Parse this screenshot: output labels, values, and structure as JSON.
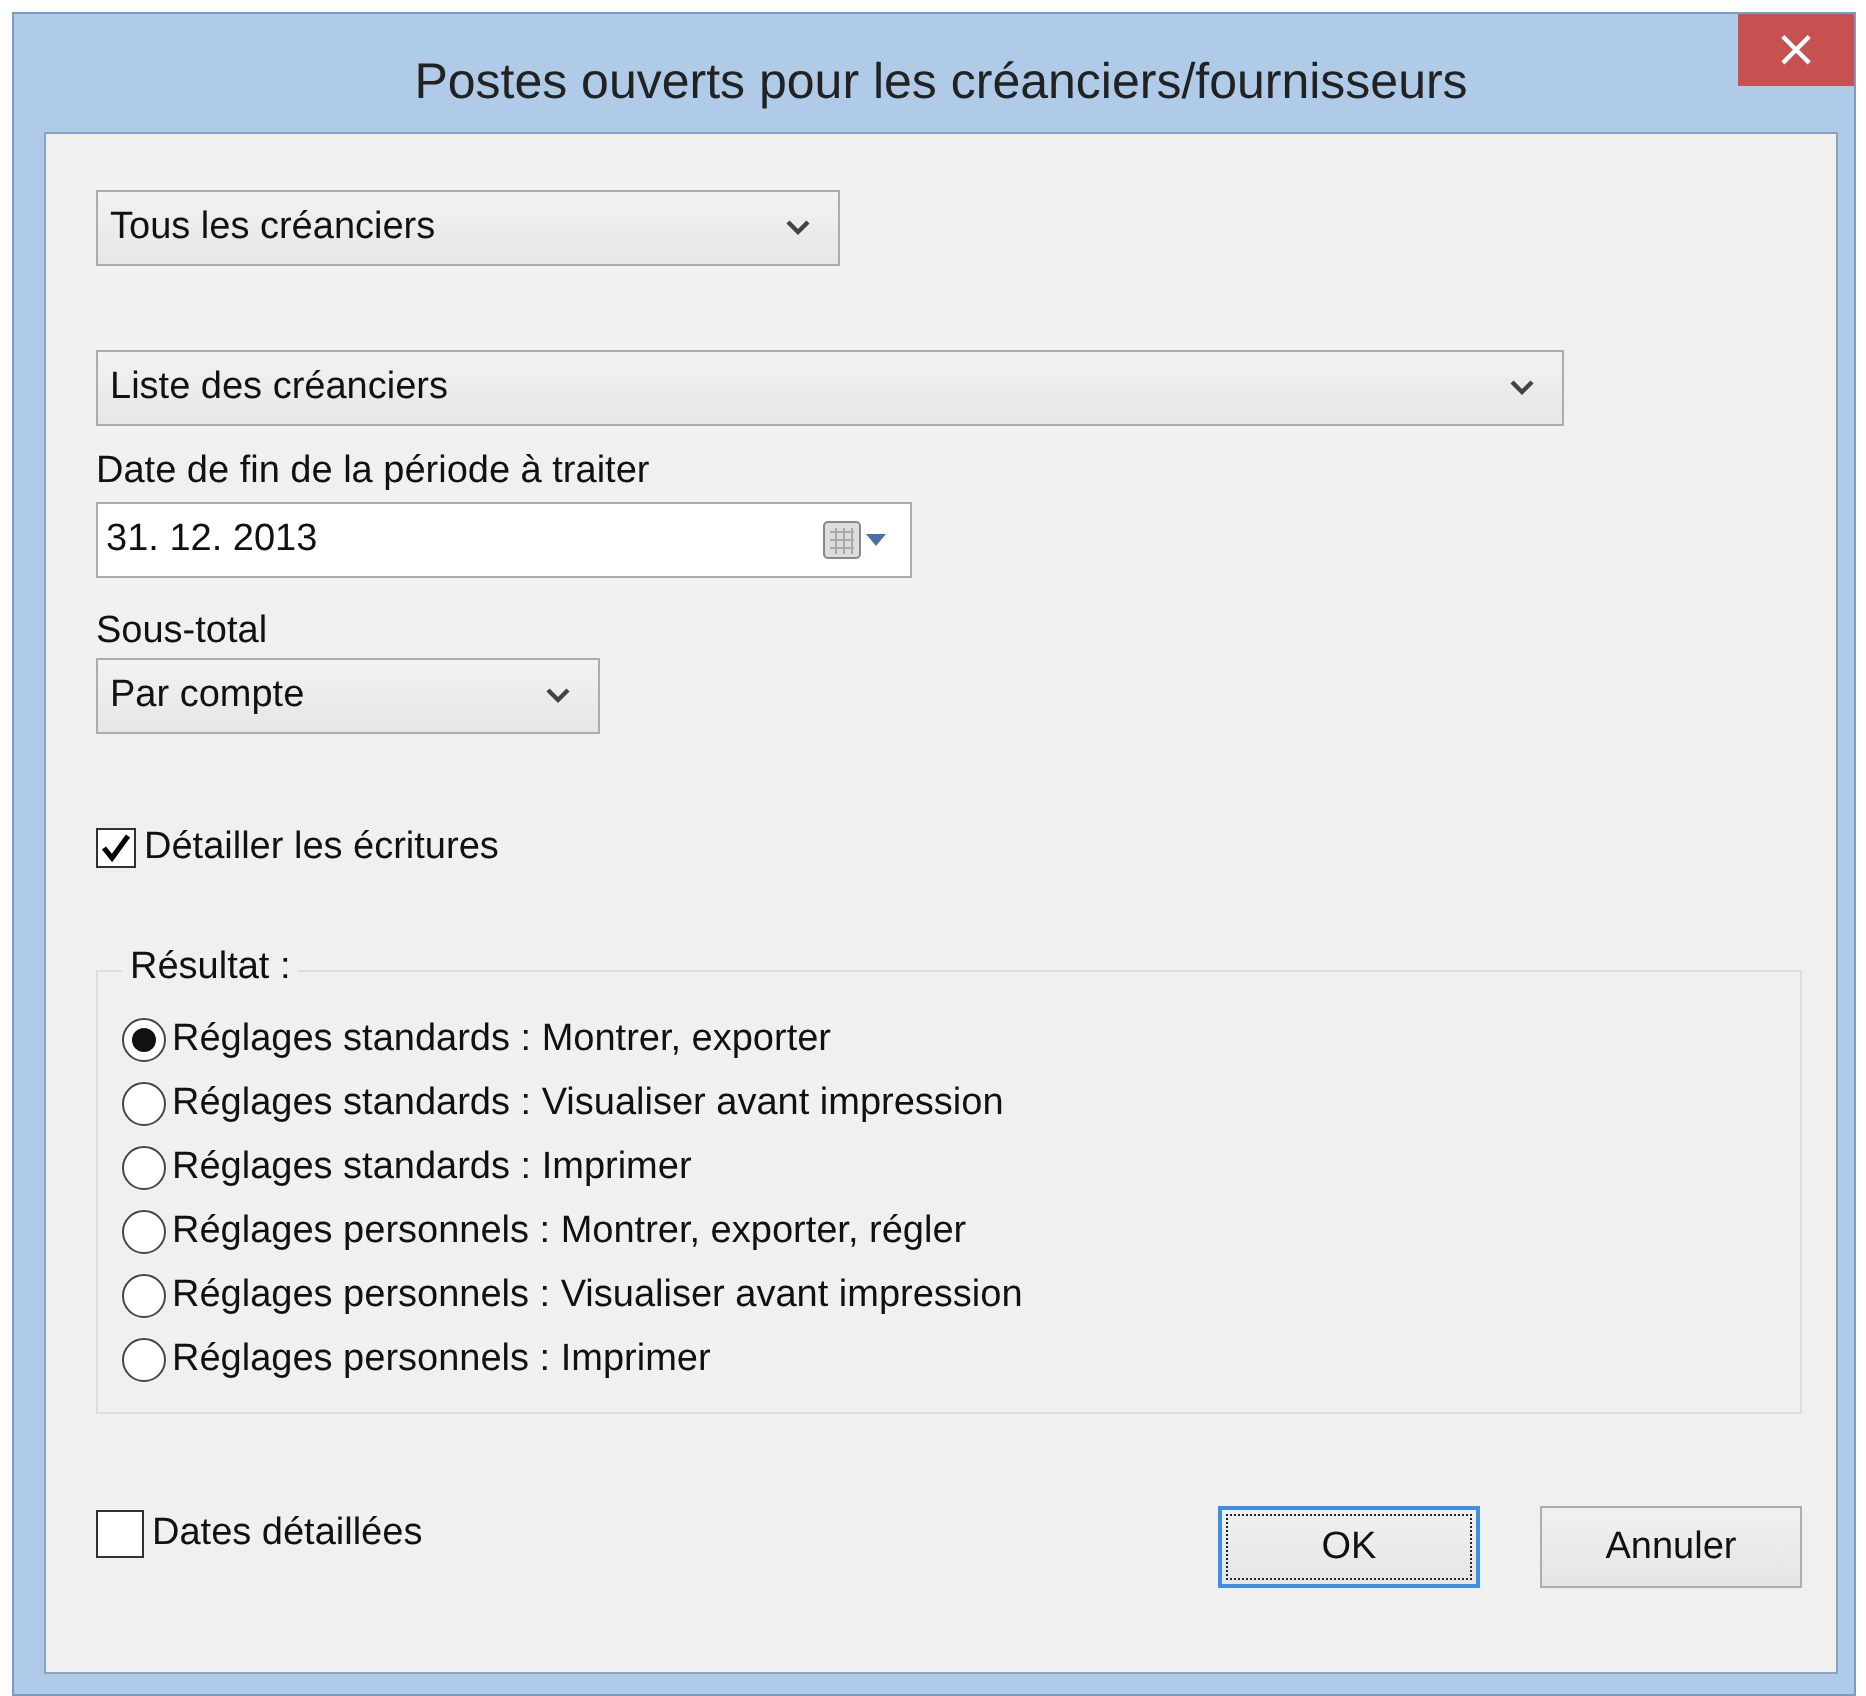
{
  "window": {
    "title": "Postes ouverts pour les créanciers/fournisseurs",
    "close": "×"
  },
  "creditor_filter": {
    "value": "Tous les créanciers"
  },
  "report_type": {
    "value": "Liste des créanciers"
  },
  "end_date": {
    "label": "Date de fin de la période à traiter",
    "value": "31. 12. 2013"
  },
  "subtotal": {
    "label": "Sous-total",
    "value": "Par compte"
  },
  "detail_entries": {
    "label": "Détailler les écritures",
    "checked": true
  },
  "result": {
    "legend": "Résultat :",
    "options": [
      {
        "label": "Réglages standards : Montrer, exporter",
        "selected": true
      },
      {
        "label": "Réglages standards : Visualiser avant impression",
        "selected": false
      },
      {
        "label": "Réglages standards : Imprimer",
        "selected": false
      },
      {
        "label": "Réglages personnels : Montrer, exporter, régler",
        "selected": false
      },
      {
        "label": "Réglages personnels : Visualiser avant impression",
        "selected": false
      },
      {
        "label": "Réglages personnels : Imprimer",
        "selected": false
      }
    ]
  },
  "detailed_dates": {
    "label": "Dates détaillées",
    "checked": false
  },
  "buttons": [
    {
      "label": "OK",
      "focused": true
    },
    {
      "label": "Annuler",
      "focused": false
    }
  ]
}
